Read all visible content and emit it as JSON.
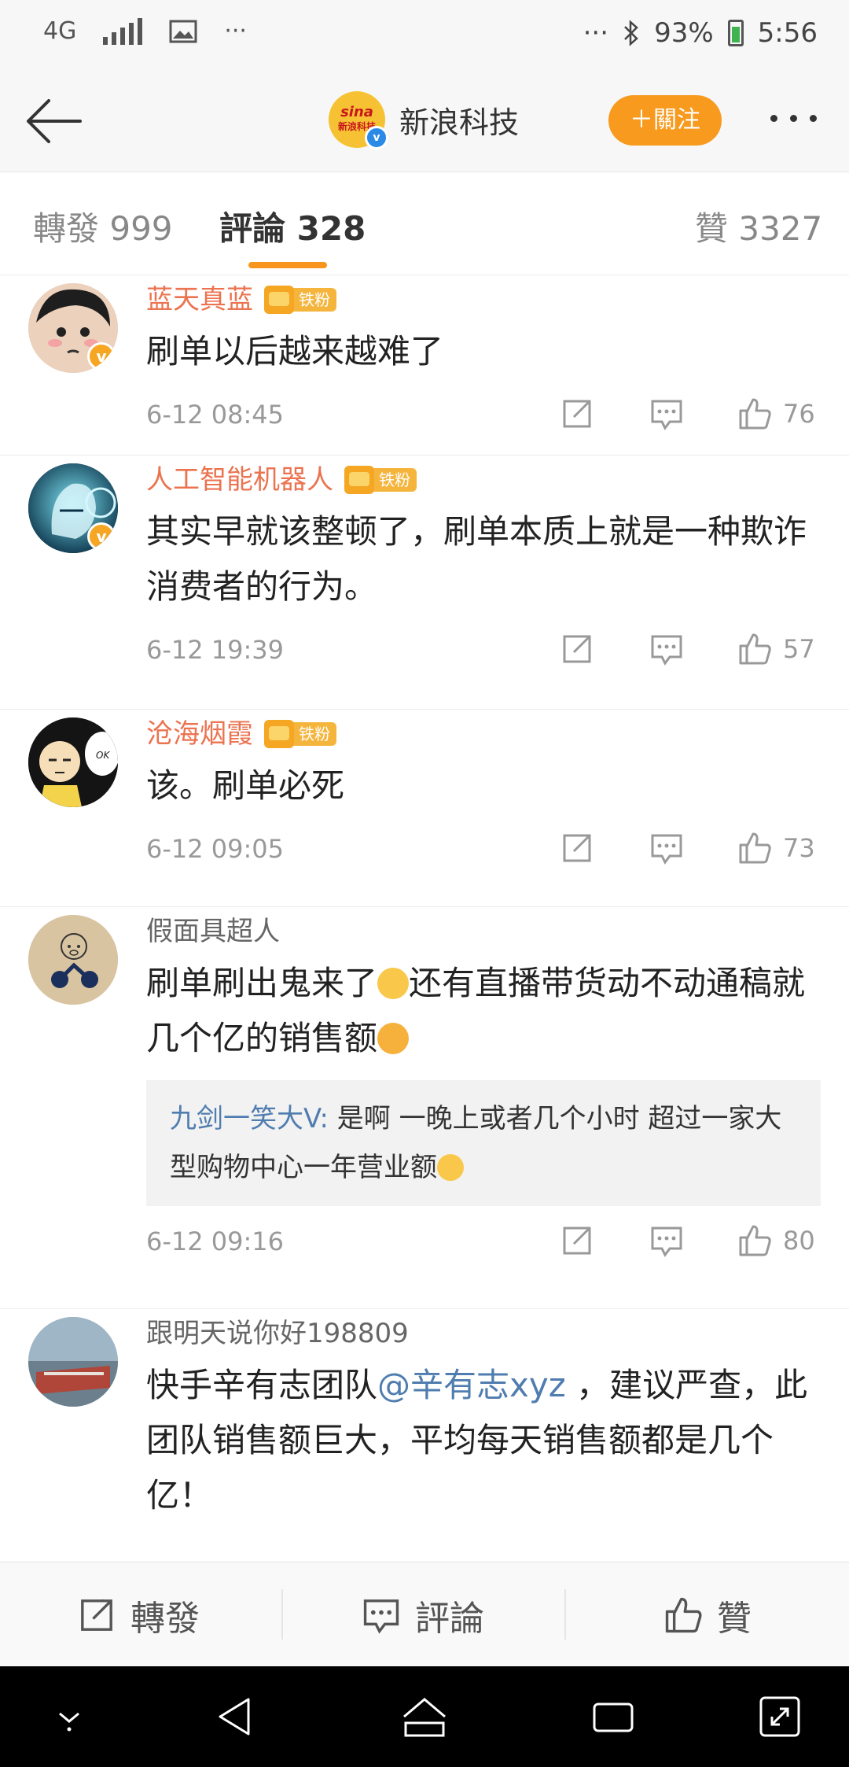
{
  "status_bar": {
    "network": "4G",
    "dots_left": "···",
    "dots_right": "···",
    "battery": "93%",
    "time": "5:56"
  },
  "header": {
    "account_name": "新浪科技",
    "logo_text": "sina",
    "logo_sub": "新浪科技",
    "follow_label": "＋關注"
  },
  "tabs": {
    "repost": "轉發 999",
    "comment": "評論 328",
    "like": "贊 3327"
  },
  "comments": [
    {
      "user": "蓝天真蓝",
      "badge": "铁粉",
      "text": "刷单以后越来越难了",
      "time": "6-12 08:45",
      "likes": "76"
    },
    {
      "user": "人工智能机器人",
      "badge": "铁粉",
      "text": "其实早就该整顿了，刷单本质上就是一种欺诈消费者的行为。",
      "time": "6-12 19:39",
      "likes": "57"
    },
    {
      "user": "沧海烟霞",
      "badge": "铁粉",
      "text": "该。刷单必死",
      "time": "6-12 09:05",
      "likes": "73"
    },
    {
      "user": "假面具超人",
      "text_a": "刷单刷出鬼来了",
      "text_b": "还有直播带货动不动通稿就几个亿的销售额",
      "reply_user": "九剑一笑大V:",
      "reply_text": " 是啊 一晚上或者几个小时 超过一家大型购物中心一年营业额",
      "time": "6-12 09:16",
      "likes": "80"
    },
    {
      "user": "跟明天说你好198809",
      "text_a": "快手辛有志团队",
      "mention": "@辛有志xyz",
      "text_b": " ，建议严查，此团队销售额巨大，平均每天销售额都是几个亿！"
    }
  ],
  "bottom_bar": {
    "repost": "轉發",
    "comment": "評論",
    "like": "贊"
  }
}
